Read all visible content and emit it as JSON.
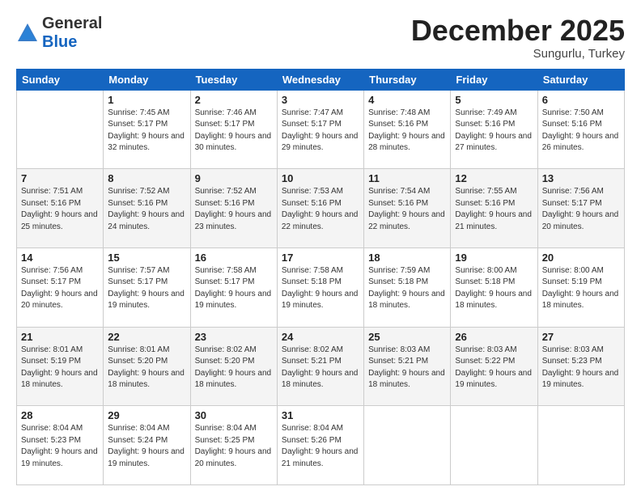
{
  "header": {
    "logo_general": "General",
    "logo_blue": "Blue",
    "month_title": "December 2025",
    "location": "Sungurlu, Turkey"
  },
  "days_of_week": [
    "Sunday",
    "Monday",
    "Tuesday",
    "Wednesday",
    "Thursday",
    "Friday",
    "Saturday"
  ],
  "weeks": [
    [
      {
        "day": "",
        "sunrise": "",
        "sunset": "",
        "daylight": ""
      },
      {
        "day": "1",
        "sunrise": "Sunrise: 7:45 AM",
        "sunset": "Sunset: 5:17 PM",
        "daylight": "Daylight: 9 hours and 32 minutes."
      },
      {
        "day": "2",
        "sunrise": "Sunrise: 7:46 AM",
        "sunset": "Sunset: 5:17 PM",
        "daylight": "Daylight: 9 hours and 30 minutes."
      },
      {
        "day": "3",
        "sunrise": "Sunrise: 7:47 AM",
        "sunset": "Sunset: 5:17 PM",
        "daylight": "Daylight: 9 hours and 29 minutes."
      },
      {
        "day": "4",
        "sunrise": "Sunrise: 7:48 AM",
        "sunset": "Sunset: 5:16 PM",
        "daylight": "Daylight: 9 hours and 28 minutes."
      },
      {
        "day": "5",
        "sunrise": "Sunrise: 7:49 AM",
        "sunset": "Sunset: 5:16 PM",
        "daylight": "Daylight: 9 hours and 27 minutes."
      },
      {
        "day": "6",
        "sunrise": "Sunrise: 7:50 AM",
        "sunset": "Sunset: 5:16 PM",
        "daylight": "Daylight: 9 hours and 26 minutes."
      }
    ],
    [
      {
        "day": "7",
        "sunrise": "Sunrise: 7:51 AM",
        "sunset": "Sunset: 5:16 PM",
        "daylight": "Daylight: 9 hours and 25 minutes."
      },
      {
        "day": "8",
        "sunrise": "Sunrise: 7:52 AM",
        "sunset": "Sunset: 5:16 PM",
        "daylight": "Daylight: 9 hours and 24 minutes."
      },
      {
        "day": "9",
        "sunrise": "Sunrise: 7:52 AM",
        "sunset": "Sunset: 5:16 PM",
        "daylight": "Daylight: 9 hours and 23 minutes."
      },
      {
        "day": "10",
        "sunrise": "Sunrise: 7:53 AM",
        "sunset": "Sunset: 5:16 PM",
        "daylight": "Daylight: 9 hours and 22 minutes."
      },
      {
        "day": "11",
        "sunrise": "Sunrise: 7:54 AM",
        "sunset": "Sunset: 5:16 PM",
        "daylight": "Daylight: 9 hours and 22 minutes."
      },
      {
        "day": "12",
        "sunrise": "Sunrise: 7:55 AM",
        "sunset": "Sunset: 5:16 PM",
        "daylight": "Daylight: 9 hours and 21 minutes."
      },
      {
        "day": "13",
        "sunrise": "Sunrise: 7:56 AM",
        "sunset": "Sunset: 5:17 PM",
        "daylight": "Daylight: 9 hours and 20 minutes."
      }
    ],
    [
      {
        "day": "14",
        "sunrise": "Sunrise: 7:56 AM",
        "sunset": "Sunset: 5:17 PM",
        "daylight": "Daylight: 9 hours and 20 minutes."
      },
      {
        "day": "15",
        "sunrise": "Sunrise: 7:57 AM",
        "sunset": "Sunset: 5:17 PM",
        "daylight": "Daylight: 9 hours and 19 minutes."
      },
      {
        "day": "16",
        "sunrise": "Sunrise: 7:58 AM",
        "sunset": "Sunset: 5:17 PM",
        "daylight": "Daylight: 9 hours and 19 minutes."
      },
      {
        "day": "17",
        "sunrise": "Sunrise: 7:58 AM",
        "sunset": "Sunset: 5:18 PM",
        "daylight": "Daylight: 9 hours and 19 minutes."
      },
      {
        "day": "18",
        "sunrise": "Sunrise: 7:59 AM",
        "sunset": "Sunset: 5:18 PM",
        "daylight": "Daylight: 9 hours and 18 minutes."
      },
      {
        "day": "19",
        "sunrise": "Sunrise: 8:00 AM",
        "sunset": "Sunset: 5:18 PM",
        "daylight": "Daylight: 9 hours and 18 minutes."
      },
      {
        "day": "20",
        "sunrise": "Sunrise: 8:00 AM",
        "sunset": "Sunset: 5:19 PM",
        "daylight": "Daylight: 9 hours and 18 minutes."
      }
    ],
    [
      {
        "day": "21",
        "sunrise": "Sunrise: 8:01 AM",
        "sunset": "Sunset: 5:19 PM",
        "daylight": "Daylight: 9 hours and 18 minutes."
      },
      {
        "day": "22",
        "sunrise": "Sunrise: 8:01 AM",
        "sunset": "Sunset: 5:20 PM",
        "daylight": "Daylight: 9 hours and 18 minutes."
      },
      {
        "day": "23",
        "sunrise": "Sunrise: 8:02 AM",
        "sunset": "Sunset: 5:20 PM",
        "daylight": "Daylight: 9 hours and 18 minutes."
      },
      {
        "day": "24",
        "sunrise": "Sunrise: 8:02 AM",
        "sunset": "Sunset: 5:21 PM",
        "daylight": "Daylight: 9 hours and 18 minutes."
      },
      {
        "day": "25",
        "sunrise": "Sunrise: 8:03 AM",
        "sunset": "Sunset: 5:21 PM",
        "daylight": "Daylight: 9 hours and 18 minutes."
      },
      {
        "day": "26",
        "sunrise": "Sunrise: 8:03 AM",
        "sunset": "Sunset: 5:22 PM",
        "daylight": "Daylight: 9 hours and 19 minutes."
      },
      {
        "day": "27",
        "sunrise": "Sunrise: 8:03 AM",
        "sunset": "Sunset: 5:23 PM",
        "daylight": "Daylight: 9 hours and 19 minutes."
      }
    ],
    [
      {
        "day": "28",
        "sunrise": "Sunrise: 8:04 AM",
        "sunset": "Sunset: 5:23 PM",
        "daylight": "Daylight: 9 hours and 19 minutes."
      },
      {
        "day": "29",
        "sunrise": "Sunrise: 8:04 AM",
        "sunset": "Sunset: 5:24 PM",
        "daylight": "Daylight: 9 hours and 19 minutes."
      },
      {
        "day": "30",
        "sunrise": "Sunrise: 8:04 AM",
        "sunset": "Sunset: 5:25 PM",
        "daylight": "Daylight: 9 hours and 20 minutes."
      },
      {
        "day": "31",
        "sunrise": "Sunrise: 8:04 AM",
        "sunset": "Sunset: 5:26 PM",
        "daylight": "Daylight: 9 hours and 21 minutes."
      },
      {
        "day": "",
        "sunrise": "",
        "sunset": "",
        "daylight": ""
      },
      {
        "day": "",
        "sunrise": "",
        "sunset": "",
        "daylight": ""
      },
      {
        "day": "",
        "sunrise": "",
        "sunset": "",
        "daylight": ""
      }
    ]
  ]
}
